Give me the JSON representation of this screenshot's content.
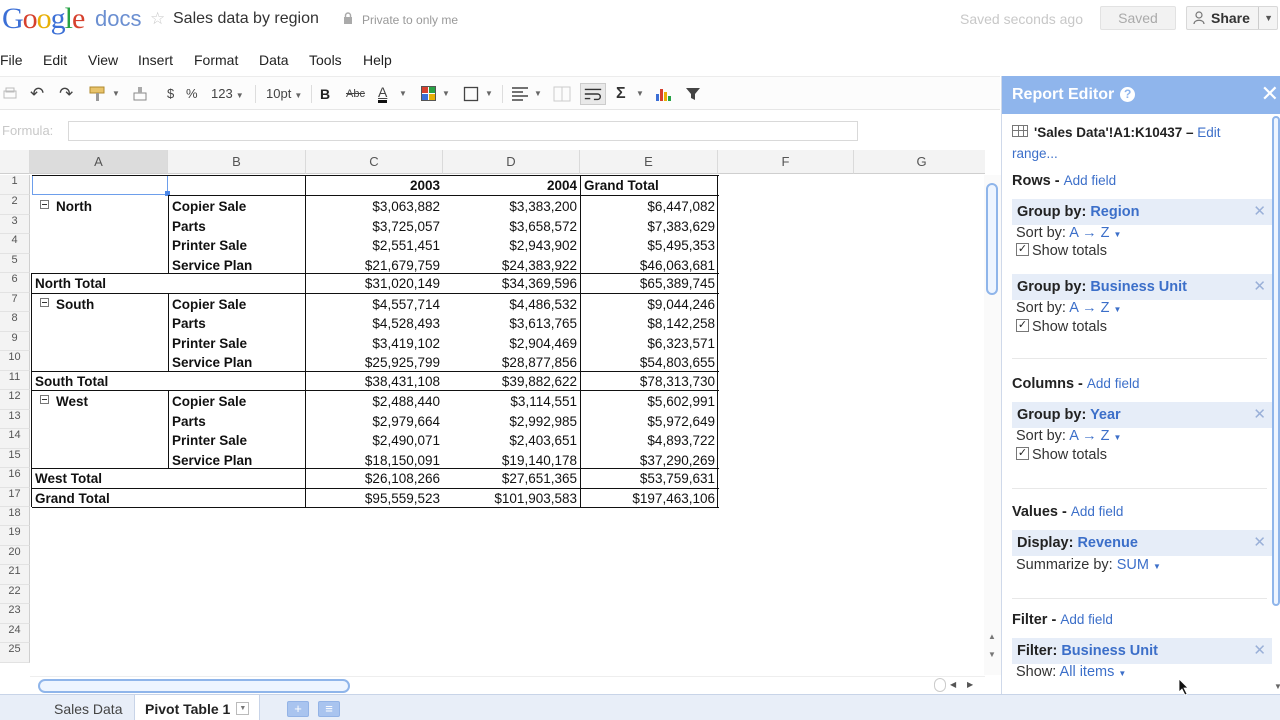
{
  "header": {
    "logo_letters": [
      {
        "ch": "G",
        "color": "#3b6fd6"
      },
      {
        "ch": "o",
        "color": "#d6402d"
      },
      {
        "ch": "o",
        "color": "#e8b007"
      },
      {
        "ch": "g",
        "color": "#3b6fd6"
      },
      {
        "ch": "l",
        "color": "#27a245"
      },
      {
        "ch": "e",
        "color": "#d6402d"
      }
    ],
    "product": "docs",
    "doc_title": "Sales data by region",
    "privacy": "Private to only me",
    "saved_message": "Saved seconds ago",
    "saved_button": "Saved",
    "share_button": "Share"
  },
  "menu": [
    "File",
    "Edit",
    "View",
    "Insert",
    "Format",
    "Data",
    "Tools",
    "Help"
  ],
  "toolbar": {
    "currency": "$",
    "percent": "%",
    "number_format": "123",
    "font_size": "10pt",
    "bold": "B",
    "strikethrough": "Abc",
    "text_color": "A",
    "sum": "Σ"
  },
  "formula": {
    "label": "Formula:",
    "value": ""
  },
  "columns": [
    "A",
    "B",
    "C",
    "D",
    "E",
    "F",
    "G"
  ],
  "rows": [
    "1",
    "2",
    "3",
    "4",
    "5",
    "6",
    "7",
    "8",
    "9",
    "10",
    "11",
    "12",
    "13",
    "14",
    "15",
    "16",
    "17",
    "18",
    "19",
    "20",
    "21",
    "22",
    "23",
    "24",
    "25"
  ],
  "pivot": {
    "headers": {
      "c": "2003",
      "d": "2004",
      "e": "Grand Total"
    },
    "regions": [
      {
        "name": "North",
        "items": [
          {
            "unit": "Copier Sale",
            "c": "$3,063,882",
            "d": "$3,383,200",
            "e": "$6,447,082"
          },
          {
            "unit": "Parts",
            "c": "$3,725,057",
            "d": "$3,658,572",
            "e": "$7,383,629"
          },
          {
            "unit": "Printer Sale",
            "c": "$2,551,451",
            "d": "$2,943,902",
            "e": "$5,495,353"
          },
          {
            "unit": "Service Plan",
            "c": "$21,679,759",
            "d": "$24,383,922",
            "e": "$46,063,681"
          }
        ],
        "total": {
          "label": "North Total",
          "c": "$31,020,149",
          "d": "$34,369,596",
          "e": "$65,389,745"
        }
      },
      {
        "name": "South",
        "items": [
          {
            "unit": "Copier Sale",
            "c": "$4,557,714",
            "d": "$4,486,532",
            "e": "$9,044,246"
          },
          {
            "unit": "Parts",
            "c": "$4,528,493",
            "d": "$3,613,765",
            "e": "$8,142,258"
          },
          {
            "unit": "Printer Sale",
            "c": "$3,419,102",
            "d": "$2,904,469",
            "e": "$6,323,571"
          },
          {
            "unit": "Service Plan",
            "c": "$25,925,799",
            "d": "$28,877,856",
            "e": "$54,803,655"
          }
        ],
        "total": {
          "label": "South Total",
          "c": "$38,431,108",
          "d": "$39,882,622",
          "e": "$78,313,730"
        }
      },
      {
        "name": "West",
        "items": [
          {
            "unit": "Copier Sale",
            "c": "$2,488,440",
            "d": "$3,114,551",
            "e": "$5,602,991"
          },
          {
            "unit": "Parts",
            "c": "$2,979,664",
            "d": "$2,992,985",
            "e": "$5,972,649"
          },
          {
            "unit": "Printer Sale",
            "c": "$2,490,071",
            "d": "$2,403,651",
            "e": "$4,893,722"
          },
          {
            "unit": "Service Plan",
            "c": "$18,150,091",
            "d": "$19,140,178",
            "e": "$37,290,269"
          }
        ],
        "total": {
          "label": "West Total",
          "c": "$26,108,266",
          "d": "$27,651,365",
          "e": "$53,759,631"
        }
      }
    ],
    "grand_total": {
      "label": "Grand Total",
      "c": "$95,559,523",
      "d": "$101,903,583",
      "e": "$197,463,106"
    }
  },
  "sheets": {
    "tab1": "Sales Data",
    "tab2": "Pivot Table 1"
  },
  "report_editor": {
    "title": "Report Editor",
    "range_text": "'Sales Data'!A1:K10437 –",
    "range_link1": "Edit",
    "range_link2": "range...",
    "add_field": "Add field",
    "sort_by_label": "Sort by:",
    "sort_value": "A → Z",
    "show_totals": "Show totals",
    "rows_label": "Rows -",
    "row_group1_label": "Group by:",
    "row_group1_value": "Region",
    "row_group2_label": "Group by:",
    "row_group2_value": "Business Unit",
    "columns_label": "Columns -",
    "col_group_label": "Group by:",
    "col_group_value": "Year",
    "values_label": "Values -",
    "display_label": "Display:",
    "display_value": "Revenue",
    "summarize_label": "Summarize by:",
    "summarize_value": "SUM",
    "filter_label": "Filter -",
    "filter_field_label": "Filter:",
    "filter_field_value": "Business Unit",
    "show_label": "Show:",
    "show_value": "All items"
  }
}
